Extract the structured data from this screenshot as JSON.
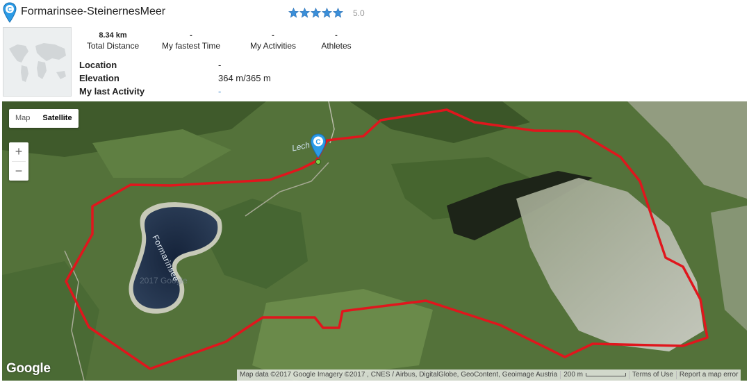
{
  "header": {
    "title": "Formarinsee-SteinernesMeer",
    "pin_letter": "C",
    "rating_value": "5.0",
    "stars_filled": 5,
    "star_color": "#3b8fd9"
  },
  "stats": [
    {
      "value": "8.34 km",
      "label": "Total Distance"
    },
    {
      "value": "-",
      "label": "My fastest Time"
    },
    {
      "value": "-",
      "label": "My Activities"
    },
    {
      "value": "-",
      "label": "Athletes"
    }
  ],
  "info": {
    "location_label": "Location",
    "location_value": "-",
    "elevation_label": "Elevation",
    "elevation_value": "364 m/365 m",
    "last_activity_label": "My last Activity",
    "last_activity_value": "-"
  },
  "map": {
    "type_map_label": "Map",
    "type_satellite_label": "Satellite",
    "zoom_in_label": "+",
    "zoom_out_label": "−",
    "lake_label": "Formarinsee",
    "river_label": "Lech",
    "watermark": "2017 Google",
    "logo_text": "Google",
    "attribution": "Map data ©2017 Google Imagery ©2017 , CNES / Airbus, DigitalGlobe, GeoContent, Geoimage Austria",
    "scale_label": "200 m",
    "terms_label": "Terms of Use",
    "report_label": "Report a map error",
    "route_color": "#e0161d",
    "pin_color": "#2b9be6"
  }
}
